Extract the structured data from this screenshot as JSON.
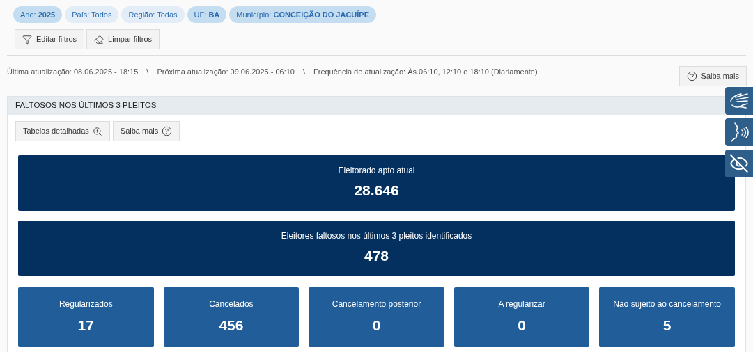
{
  "filters": [
    {
      "label": "Ano:",
      "value": "2025",
      "active": true
    },
    {
      "label": "País: Todos",
      "active": false
    },
    {
      "label": "Região: Todas",
      "active": false
    },
    {
      "label": "UF:",
      "value": "BA",
      "active": true
    },
    {
      "label": "Município:",
      "value": "CONCEIÇÃO DO JACUÍPE",
      "active": true
    }
  ],
  "filter_buttons": [
    {
      "kind": "filter",
      "label": "Editar filtros"
    },
    {
      "kind": "eraser",
      "label": "Limpar filtros"
    }
  ],
  "update_info": [
    "Última atualização: 08.06.2025 - 18:15",
    "\\",
    "Próxima atualização: 09.06.2025 - 06:10",
    "\\",
    "Frequência de atualização: Às 06:10, 12:10 e 18:10 (Diariamente)"
  ],
  "help_button": "Saiba mais",
  "panel": {
    "title": "FALTOSOS NOS ÚLTIMOS 3 PLEITOS",
    "buttons": [
      {
        "kind": "zoom",
        "label": "Tabelas detalhadas"
      },
      {
        "kind": "help",
        "label": "Saiba mais"
      }
    ],
    "main_cards": [
      {
        "label": "Eleitorado apto atual",
        "value": "28.646"
      },
      {
        "label": "Eleitores faltosos nos últimos 3 pleitos identificados",
        "value": "478"
      }
    ],
    "cards": [
      {
        "label": "Regularizados",
        "value": "17"
      },
      {
        "label": "Cancelados",
        "value": "456"
      },
      {
        "label": "Cancelamento posterior",
        "value": "0"
      },
      {
        "label": "A regularizar",
        "value": "0"
      },
      {
        "label": "Não sujeito ao cancelamento",
        "value": "5"
      }
    ]
  },
  "accessibility": [
    {
      "kind": "sign"
    },
    {
      "kind": "speech"
    },
    {
      "kind": "eye"
    }
  ]
}
